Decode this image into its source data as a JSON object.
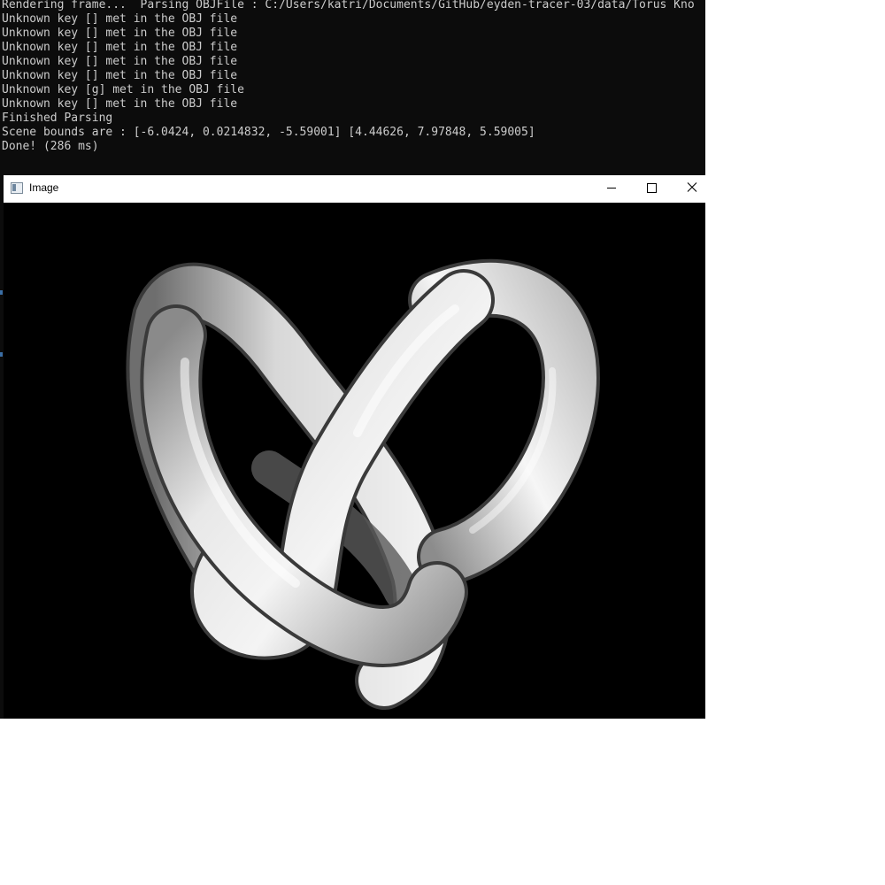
{
  "console": {
    "lines": [
      "Rendering frame...  Parsing OBJFile : C:/Users/katri/Documents/GitHub/eyden-tracer-03/data/Torus Kno",
      "Unknown key [] met in the OBJ file",
      "Unknown key [] met in the OBJ file",
      "Unknown key [] met in the OBJ file",
      "Unknown key [] met in the OBJ file",
      "Unknown key [] met in the OBJ file",
      "Unknown key [g] met in the OBJ file",
      "Unknown key [] met in the OBJ file",
      "Finished Parsing",
      "Scene bounds are : [-6.0424, 0.0214832, -5.59001] [4.44626, 7.97848, 5.59005]",
      "Done! (286 ms)"
    ]
  },
  "window": {
    "title": "Image",
    "icons": {
      "app": "app-window-icon",
      "minimize": "minimize-icon",
      "maximize": "maximize-icon",
      "close": "close-icon"
    },
    "content": "rendered-torus-knot-image"
  },
  "colors": {
    "console_bg": "#0c0c0c",
    "console_text": "#cccccc",
    "render_bg": "#000000"
  }
}
